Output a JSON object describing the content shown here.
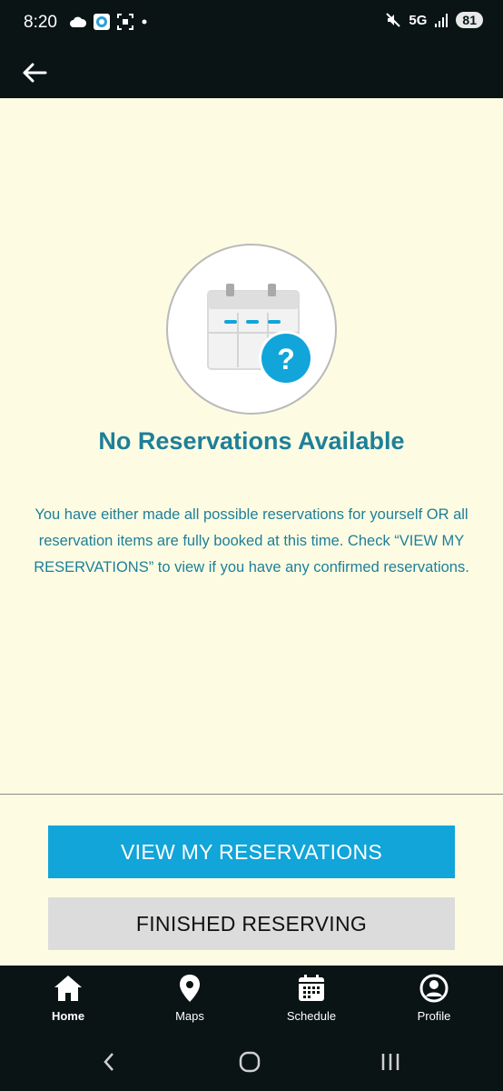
{
  "status_bar": {
    "time": "8:20",
    "network": "5G",
    "battery": "81",
    "icons": [
      "cloud-icon",
      "app-notification-icon",
      "screenshot-icon",
      "dot-icon",
      "mute-icon",
      "signal-icon"
    ]
  },
  "app_bar": {
    "back_icon": "arrow-left-icon"
  },
  "empty_state": {
    "illustration": "calendar-question-icon",
    "title": "No Reservations Available",
    "message": "You have either made all possible reservations for yourself OR all reservation items are fully booked at this time. Check “VIEW MY RESERVATIONS” to view if you have any confirmed reservations."
  },
  "actions": {
    "view_reservations": "VIEW MY RESERVATIONS",
    "finished_reserving": "FINISHED RESERVING"
  },
  "bottom_nav": {
    "items": [
      {
        "label": "Home",
        "icon": "home-icon",
        "active": true
      },
      {
        "label": "Maps",
        "icon": "map-pin-icon",
        "active": false
      },
      {
        "label": "Schedule",
        "icon": "calendar-icon",
        "active": false
      },
      {
        "label": "Profile",
        "icon": "profile-icon",
        "active": false
      }
    ]
  },
  "system_nav": {
    "icons": [
      "back-chevron-icon",
      "home-circle-icon",
      "recents-icon"
    ]
  },
  "colors": {
    "background": "#fdfce3",
    "bars": "#0a1414",
    "accent": "#1e7f99",
    "primary_button": "#11a5d9",
    "secondary_button": "#dcdcdc"
  }
}
